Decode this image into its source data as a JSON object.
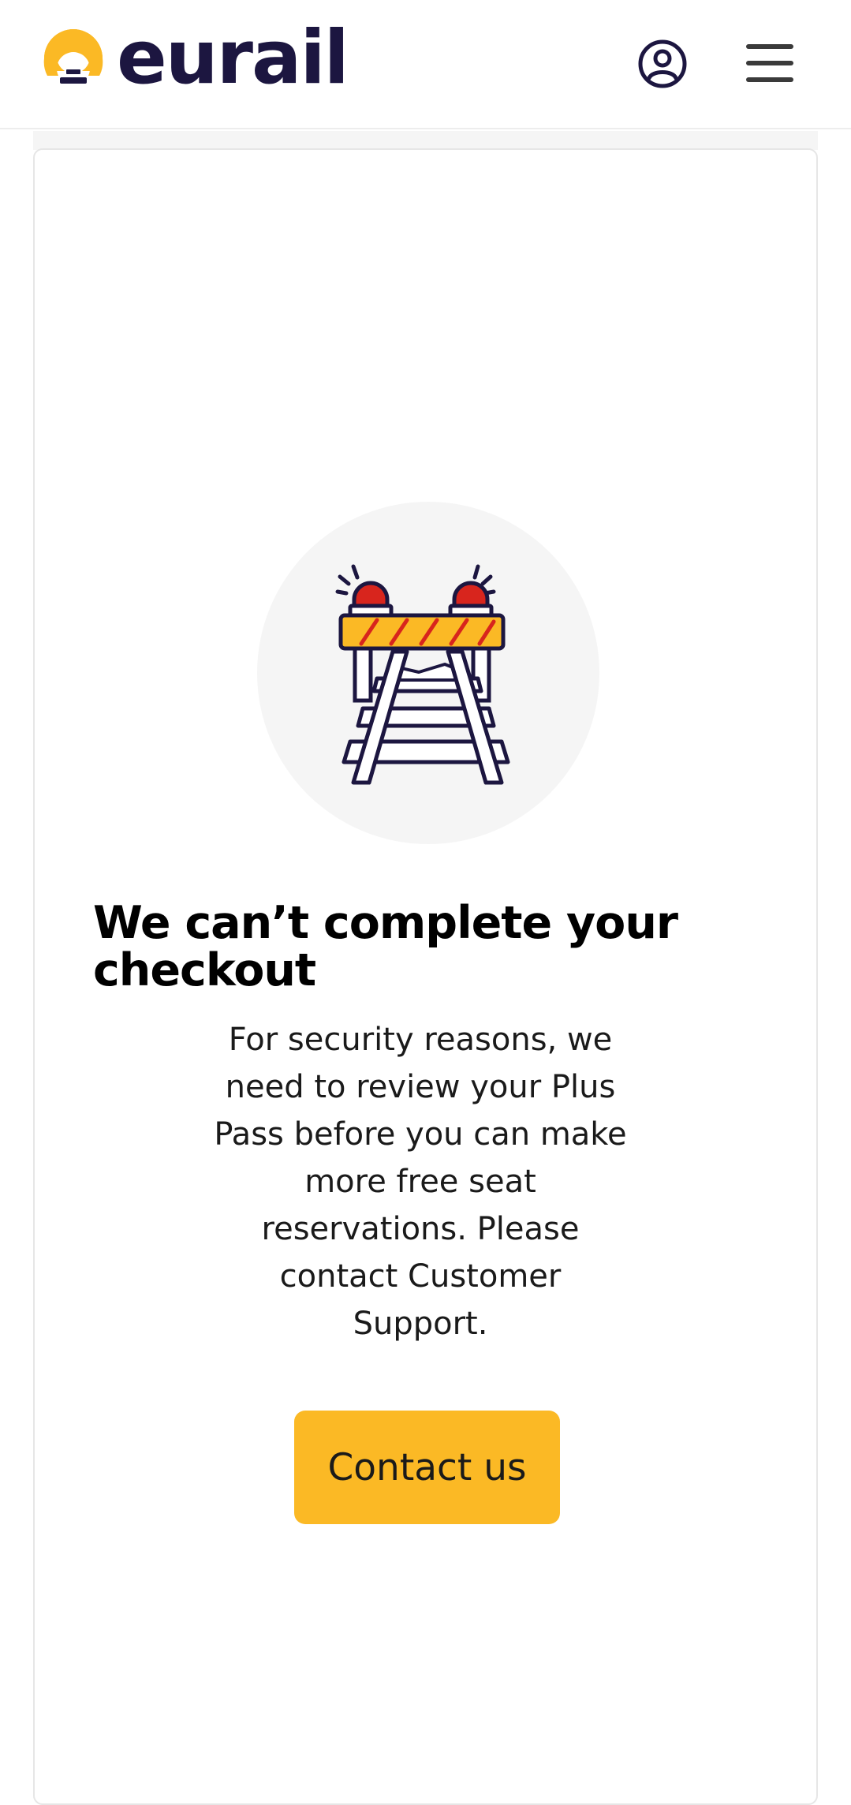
{
  "header": {
    "brand": "eurail",
    "icons": {
      "logo": "eurail-logo-icon",
      "profile": "user-profile-icon",
      "menu": "hamburger-menu-icon"
    }
  },
  "error": {
    "illustration": "blocked-railway-barrier-icon",
    "title": "We can’t complete your checkout",
    "message": "For security reasons, we need to review your Plus Pass before you can make more free seat reservations. Please contact Customer Support.",
    "button_label": "Contact us"
  },
  "colors": {
    "brand_dark": "#1c1640",
    "accent_yellow": "#fbb925",
    "siren_red": "#d8251d"
  }
}
